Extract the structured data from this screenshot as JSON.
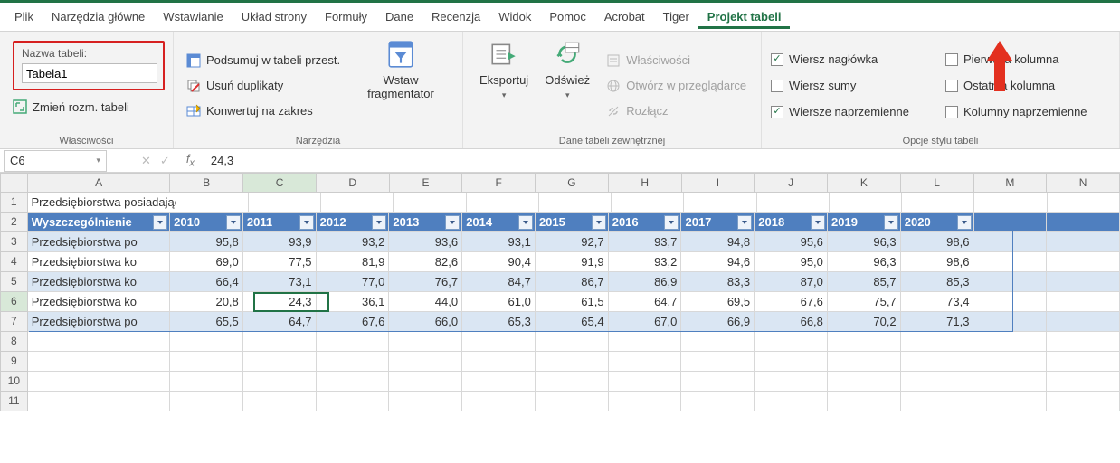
{
  "menubar": {
    "items": [
      "Plik",
      "Narzędzia główne",
      "Wstawianie",
      "Układ strony",
      "Formuły",
      "Dane",
      "Recenzja",
      "Widok",
      "Pomoc",
      "Acrobat",
      "Tiger",
      "Projekt tabeli"
    ],
    "active": "Projekt tabeli"
  },
  "ribbon": {
    "table_name_label": "Nazwa tabeli:",
    "table_name_value": "Tabela1",
    "resize_table": "Zmień rozm. tabeli",
    "group_props": "Właściwości",
    "summarize": "Podsumuj w tabeli przest.",
    "dedup": "Usuń duplikaty",
    "to_range": "Konwertuj na zakres",
    "slicer_top": "Wstaw",
    "slicer_bottom": "fragmentator",
    "group_tools": "Narzędzia",
    "export": "Eksportuj",
    "refresh": "Odśwież",
    "props": "Właściwości",
    "browser": "Otwórz w przeglądarce",
    "unlink": "Rozłącz",
    "group_external": "Dane tabeli zewnętrznej",
    "opt_header": "Wiersz nagłówka",
    "opt_total": "Wiersz sumy",
    "opt_banded_rows": "Wiersze naprzemienne",
    "opt_first_col": "Pierwsza kolumna",
    "opt_last_col": "Ostatnia kolumna",
    "opt_banded_cols": "Kolumny naprzemienne",
    "group_style": "Opcje stylu tabeli"
  },
  "fx": {
    "cellref": "C6",
    "value": "24,3"
  },
  "columns": [
    "A",
    "B",
    "C",
    "D",
    "E",
    "F",
    "G",
    "H",
    "I",
    "J",
    "K",
    "L",
    "M",
    "N"
  ],
  "chart_data": {
    "type": "table",
    "title": "Przedsiębiorstwa posiadające dostęp do internetu",
    "headers": [
      "Wyszczególnienie",
      "2010",
      "2011",
      "2012",
      "2013",
      "2014",
      "2015",
      "2016",
      "2017",
      "2018",
      "2019",
      "2020"
    ],
    "rows": [
      {
        "label": "Przedsiębiorstwa po",
        "values": [
          "95,8",
          "93,9",
          "93,2",
          "93,6",
          "93,1",
          "92,7",
          "93,7",
          "94,8",
          "95,6",
          "96,3",
          "98,6"
        ]
      },
      {
        "label": "Przedsiębiorstwa ko",
        "values": [
          "69,0",
          "77,5",
          "81,9",
          "82,6",
          "90,4",
          "91,9",
          "93,2",
          "94,6",
          "95,0",
          "96,3",
          "98,6"
        ]
      },
      {
        "label": "Przedsiębiorstwa ko",
        "values": [
          "66,4",
          "73,1",
          "77,0",
          "76,7",
          "84,7",
          "86,7",
          "86,9",
          "83,3",
          "87,0",
          "85,7",
          "85,3"
        ]
      },
      {
        "label": "Przedsiębiorstwa ko",
        "values": [
          "20,8",
          "24,3",
          "36,1",
          "44,0",
          "61,0",
          "61,5",
          "64,7",
          "69,5",
          "67,6",
          "75,7",
          "73,4"
        ]
      },
      {
        "label": "Przedsiębiorstwa po",
        "values": [
          "65,5",
          "64,7",
          "67,6",
          "66,0",
          "65,3",
          "65,4",
          "67,0",
          "66,9",
          "66,8",
          "70,2",
          "71,3"
        ]
      }
    ]
  },
  "active_cell": {
    "row": 6,
    "col": "C"
  }
}
